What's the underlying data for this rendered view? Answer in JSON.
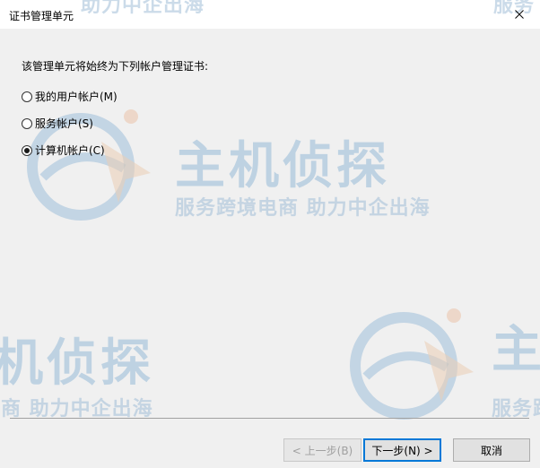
{
  "window": {
    "title": "证书管理单元"
  },
  "prompt": "该管理单元将始终为下列帐户管理证书:",
  "options": [
    {
      "label": "我的用户帐户(M)",
      "checked": false
    },
    {
      "label": "服务帐户(S)",
      "checked": false
    },
    {
      "label": "计算机帐户(C)",
      "checked": true
    }
  ],
  "buttons": {
    "back": "< 上一步(B)",
    "next": "下一步(N) >",
    "cancel": "取消"
  },
  "watermark": {
    "brand": "主机侦探",
    "slogan": "服务跨境电商 助力中企出海",
    "slogan_partial_left": "电商 助力中企出海",
    "slogan_partial_right": "服务跨",
    "brand_partial_left": "机侦探",
    "brand_partial_right": "主",
    "top_partial_left": "助力中企出海",
    "top_partial_right": "服务"
  },
  "icons": {
    "close": "close-icon",
    "watermark_logo": "globe-cursor-logo-icon"
  }
}
